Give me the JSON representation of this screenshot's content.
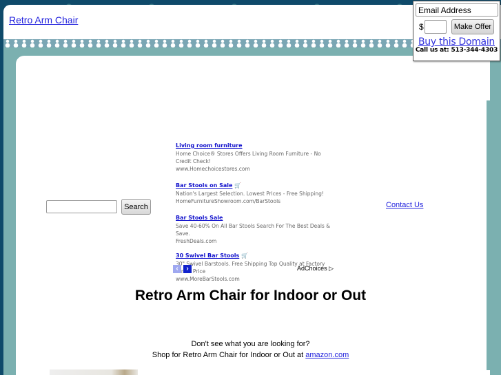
{
  "header": {
    "site_link": "Retro Arm Chair"
  },
  "search": {
    "value": "",
    "button_label": "Search"
  },
  "ads": {
    "items": [
      {
        "title": "Living room furniture",
        "has_cart_icon": false,
        "description": "Home Choice® Stores Offers Living Room Furniture - No Credit Check!",
        "url": "www.Homechoicestores.com"
      },
      {
        "title": "Bar Stools on Sale",
        "has_cart_icon": true,
        "description": "Nation's Largest Selection. Lowest Prices - Free Shipping!",
        "url": "HomeFurnitureShowroom.com/BarStools"
      },
      {
        "title": "Bar Stools Sale",
        "has_cart_icon": false,
        "description": "Save 40-60% On All Bar Stools Search For The Best Deals & Save.",
        "url": "FreshDeals.com"
      },
      {
        "title": "30 Swivel Bar Stools",
        "has_cart_icon": true,
        "description": "30\" Swivel Barstools. Free Shipping Top Quality at Factory Direct Price",
        "url": "www.MoreBarStools.com"
      }
    ],
    "prev_icon": "‹",
    "next_icon": "›",
    "adchoices_label": "AdChoices ▷"
  },
  "contact": {
    "label": "Contact Us"
  },
  "main": {
    "title": "Retro Arm Chair for Indoor or Out",
    "notice_line1": "Don't see what you are looking for?",
    "notice_line2_prefix": "Shop for Retro Arm Chair for Indoor or Out at ",
    "notice_link": "amazon.com"
  },
  "offer": {
    "email_placeholder": "Email Address",
    "currency": "$",
    "amount_value": "",
    "button_label": "Make Offer",
    "buy_link": "Buy this Domain",
    "call_us": "Call us at: 513-344-4303"
  },
  "colors": {
    "link": "#2222dd",
    "band": "#7bb0b0",
    "background": "#0f4a6a"
  }
}
